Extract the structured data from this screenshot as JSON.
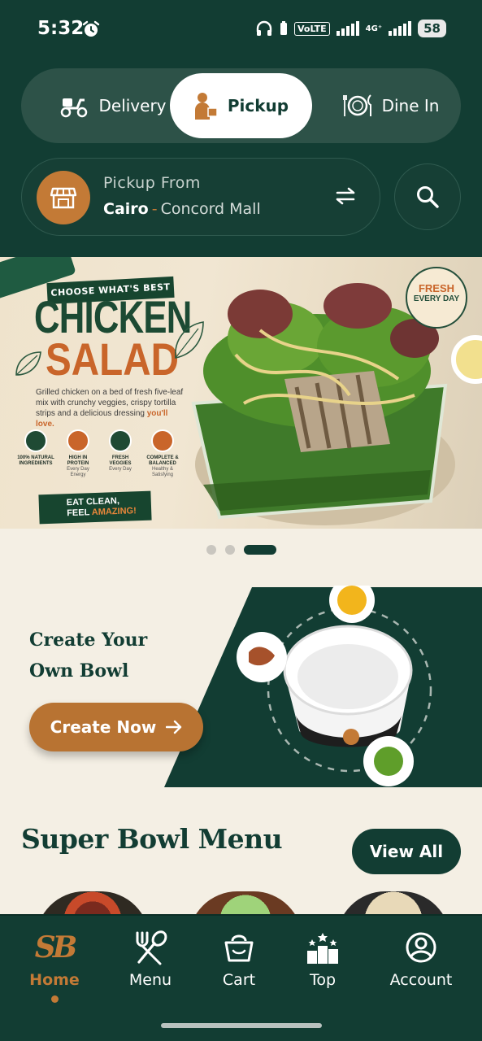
{
  "status_bar": {
    "time": "5:32",
    "volte": "VoLTE",
    "network": "4G⁺",
    "battery": "58"
  },
  "order_modes": {
    "delivery": "Delivery",
    "pickup": "Pickup",
    "dine_in": "Dine In",
    "selected": "Pickup"
  },
  "location": {
    "label": "Pickup From",
    "city": "Cairo",
    "separator": "-",
    "branch": "Concord Mall"
  },
  "banner": {
    "kicker": "CHOOSE WHAT'S BEST",
    "title": "CHICKEN",
    "subtitle": "SALAD",
    "description": "Grilled chicken on a bed of fresh five-leaf mix with crunchy veggies, crispy tortilla strips and a delicious dressing",
    "description_highlight": "you'll love.",
    "features": [
      {
        "title": "100% NATURAL INGREDIENTS",
        "sub": ""
      },
      {
        "title": "HIGH IN PROTEIN",
        "sub": "Every Day Energy"
      },
      {
        "title": "FRESH VEGGIES",
        "sub": "Every Day"
      },
      {
        "title": "COMPLETE & BALANCED",
        "sub": "Healthy & Satisfying"
      }
    ],
    "cta_line1": "EAT CLEAN,",
    "cta_line2": "FEEL",
    "cta_accent": "AMAZING!",
    "badge_line1": "FRESH",
    "badge_line2": "EVERY DAY"
  },
  "carousel": {
    "count": 3,
    "active_index": 2
  },
  "create_bowl": {
    "title_line1": "Create Your",
    "title_line2": "Own Bowl",
    "button": "Create Now"
  },
  "menu_section": {
    "title": "Super Bowl Menu",
    "view_all": "View All"
  },
  "bottom_nav": {
    "logo": "SB",
    "items": [
      {
        "label": "Home",
        "icon": "sb-logo-icon",
        "active": true
      },
      {
        "label": "Menu",
        "icon": "fork-spoon-icon",
        "active": false
      },
      {
        "label": "Cart",
        "icon": "basket-icon",
        "active": false
      },
      {
        "label": "Top",
        "icon": "podium-icon",
        "active": false
      },
      {
        "label": "Account",
        "icon": "user-circle-icon",
        "active": false
      }
    ]
  },
  "colors": {
    "primary_dark_green": "#123d33",
    "accent_copper": "#c37a36",
    "cream_background": "#f4efe4",
    "banner_orange": "#c9652a"
  }
}
